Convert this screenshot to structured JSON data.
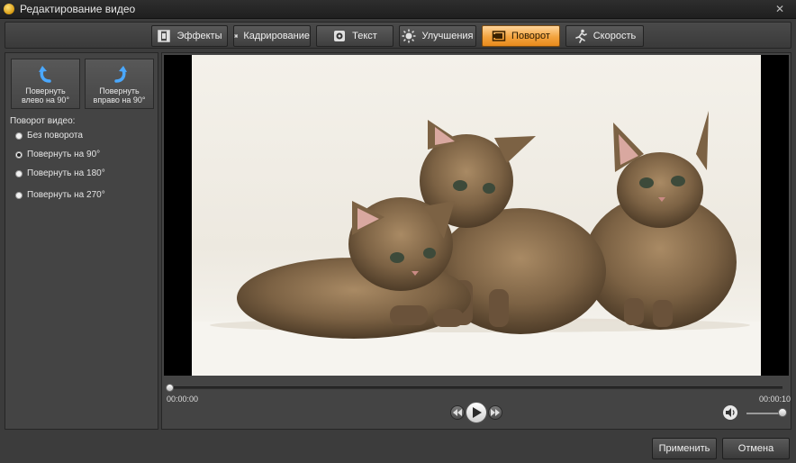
{
  "window": {
    "title": "Редактирование видео",
    "close": "✕"
  },
  "tabs": [
    {
      "label": "Эффекты",
      "icon": "effects-icon"
    },
    {
      "label": "Кадрирование",
      "icon": "crop-icon"
    },
    {
      "label": "Текст",
      "icon": "text-icon"
    },
    {
      "label": "Улучшения",
      "icon": "enhance-icon"
    },
    {
      "label": "Поворот",
      "icon": "rotate-icon",
      "active": true
    },
    {
      "label": "Скорость",
      "icon": "speed-icon"
    }
  ],
  "rotate": {
    "left_line1": "Повернуть",
    "left_line2": "влево на 90°",
    "right_line1": "Повернуть",
    "right_line2": "вправо на 90°"
  },
  "rotation": {
    "label": "Поворот видео:",
    "options": [
      {
        "label": "Без поворота",
        "checked": false
      },
      {
        "label": "Повернуть на 90°",
        "checked": true
      },
      {
        "label": "Повернуть на 180°",
        "checked": false
      },
      {
        "label": "Повернуть на 270°",
        "checked": false
      }
    ]
  },
  "player": {
    "time_current": "00:00:00",
    "time_total": "00:00:10",
    "progress": 0,
    "volume": 0.9
  },
  "footer": {
    "apply": "Применить",
    "cancel": "Отмена"
  },
  "colors": {
    "accent": "#f3a33e",
    "background": "#3c3c3c"
  }
}
